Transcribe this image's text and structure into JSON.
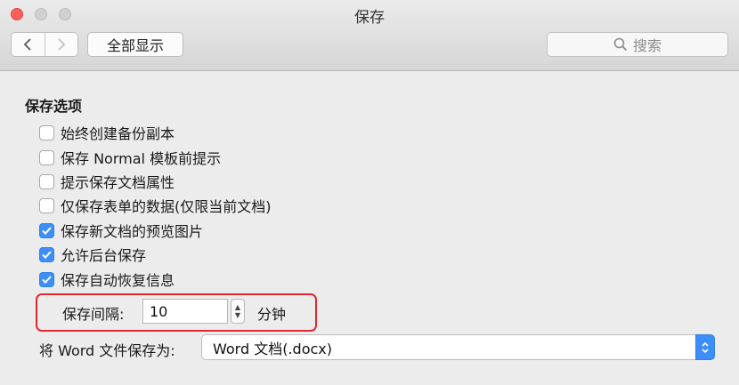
{
  "window": {
    "title": "保存"
  },
  "toolbar": {
    "back_icon": "chevron-left-icon",
    "forward_icon": "chevron-right-icon",
    "show_all_label": "全部显示",
    "search_placeholder": "搜索"
  },
  "save_options": {
    "section_title": "保存选项",
    "items": [
      {
        "label": "始终创建备份副本",
        "checked": false
      },
      {
        "label": "保存 Normal 模板前提示",
        "checked": false
      },
      {
        "label": "提示保存文档属性",
        "checked": false
      },
      {
        "label": "仅保存表单的数据(仅限当前文档)",
        "checked": false
      },
      {
        "label": "保存新文档的预览图片",
        "checked": true
      },
      {
        "label": "允许后台保存",
        "checked": true
      },
      {
        "label": "保存自动恢复信息",
        "checked": true
      }
    ]
  },
  "autosave": {
    "interval_label": "保存间隔:",
    "interval_value": "10",
    "unit_label": "分钟"
  },
  "file_format": {
    "label": "将 Word 文件保存为:",
    "selected": "Word 文档(.docx)"
  },
  "colors": {
    "accent": "#3d8ff7",
    "highlight_border": "#e0272f"
  }
}
